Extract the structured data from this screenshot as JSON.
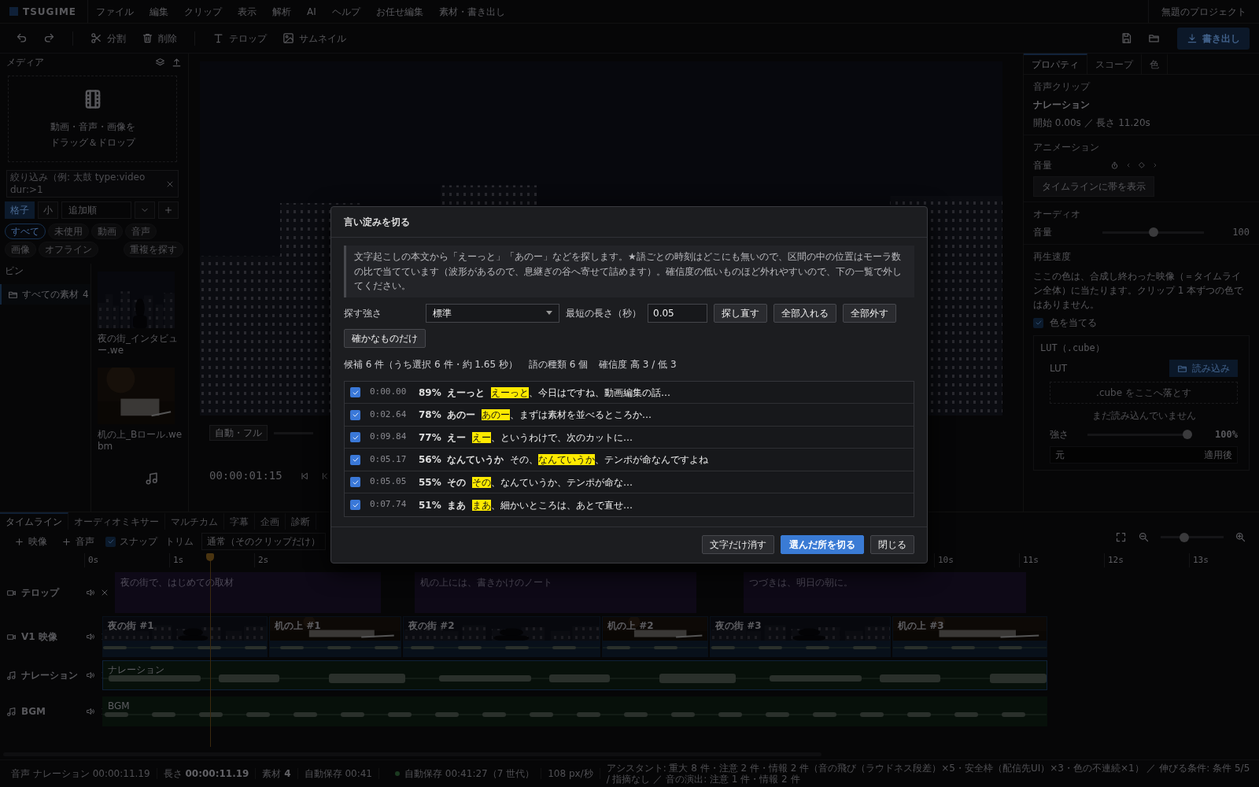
{
  "app": {
    "logo": "TSUGIME",
    "menus": [
      "ファイル",
      "編集",
      "クリップ",
      "表示",
      "解析",
      "AI",
      "ヘルプ",
      "お任せ編集",
      "素材・書き出し"
    ],
    "project": "無題のプロジェクト"
  },
  "toolbar": {
    "left": [
      {
        "kind": "undo"
      },
      {
        "kind": "redo"
      },
      {
        "kind": "split",
        "label": "分割"
      },
      {
        "kind": "delete",
        "label": "削除"
      },
      {
        "kind": "telop",
        "label": "テロップ"
      },
      {
        "kind": "thumbnail",
        "label": "サムネイル"
      }
    ],
    "right": [
      {
        "kind": "save"
      },
      {
        "kind": "open"
      }
    ],
    "export": "書き出し"
  },
  "media": {
    "title": "メディア",
    "drop_text": [
      "動画・音声・画像を",
      "ドラッグ＆ドロップ"
    ],
    "search": {
      "placeholder": "絞り込み（例: 太鼓 type:video dur:>1"
    },
    "view_modes": [
      {
        "label": "格子",
        "selected": true
      },
      {
        "label": "小",
        "selected": false
      }
    ],
    "sort": "追加順",
    "filters": [
      {
        "label": "すべて",
        "selected": true
      },
      {
        "label": "未使用",
        "selected": false
      },
      {
        "label": "動画",
        "selected": false
      },
      {
        "label": "音声",
        "selected": false
      },
      {
        "label": "画像",
        "selected": false
      },
      {
        "label": "オフライン",
        "selected": false
      }
    ],
    "find_duplicates": "重複を探す",
    "bins_title": "ビン",
    "bins": [
      {
        "label": "すべての素材",
        "count": "4",
        "selected": true
      }
    ],
    "items": [
      {
        "kind": "video",
        "name": "夜の街_インタビュー.we"
      },
      {
        "kind": "video",
        "name": "机の上_Bロール.webm"
      },
      {
        "kind": "audio"
      }
    ]
  },
  "preview": {
    "fit_button": "自動・フル",
    "timecode": "00:00:01:15"
  },
  "properties": {
    "tabs": [
      {
        "label": "プロパティ",
        "selected": true
      },
      {
        "label": "スコープ",
        "selected": false
      },
      {
        "label": "色",
        "selected": false
      }
    ],
    "clip_type": "音声クリップ",
    "clip_name": "ナレーション",
    "clip_timing": "開始 0.00s ／ 長さ 11.20s",
    "animation_title": "アニメーション",
    "animation_param": "音量",
    "band_button": "タイムラインに帯を表示",
    "audio_title": "オーディオ",
    "volume": {
      "label": "音量",
      "level": 0.5,
      "reading": "100"
    },
    "speed_title": "再生速度",
    "color_note": "ここの色は、合成し終わった映像（＝タイムライン全体）に当たります。クリップ 1 本ずつの色ではありません。",
    "apply_color": {
      "label": "色を当てる",
      "checked": true
    },
    "lut": {
      "title": "LUT（.cube）",
      "label": "LUT",
      "load_button": "読み込み",
      "drop_text": ".cube をここへ落とす",
      "status": "まだ読み込んでいません",
      "strength": {
        "label": "強さ",
        "level": 1,
        "reading": "100%"
      },
      "compare": {
        "before": "元",
        "after": "適用後"
      }
    }
  },
  "timeline": {
    "tabs": [
      {
        "label": "タイムライン",
        "selected": true
      },
      {
        "label": "オーディオミキサー",
        "selected": false
      },
      {
        "label": "マルチカム",
        "selected": false
      },
      {
        "label": "字幕",
        "selected": false
      },
      {
        "label": "企画",
        "selected": false
      },
      {
        "label": "診断",
        "selected": false
      }
    ],
    "add_video": "映像",
    "add_audio": "音声",
    "snap": {
      "label": "スナップ",
      "checked": true
    },
    "trim_label": "トリム",
    "trim_mode": "通常（そのクリップだけ）",
    "zoom": {
      "level": 0.35
    },
    "ruler": [
      "0s",
      "1s",
      "2s",
      "10s",
      "11s",
      "12s",
      "13s"
    ],
    "tracks": [
      {
        "kind": "text",
        "name": "テロップ",
        "clips": [
          {
            "label": "夜の街で、はじめての取材",
            "selected": false
          },
          {
            "label": "机の上には、書きかけのノート",
            "selected": false
          },
          {
            "label": "つづきは、明日の朝に。",
            "selected": false
          }
        ]
      },
      {
        "kind": "video",
        "name": "V1 映像",
        "clips": [
          {
            "label": "夜の街 #1",
            "selected": false
          },
          {
            "label": "机の上 #1",
            "selected": false
          },
          {
            "label": "夜の街 #2",
            "selected": false
          },
          {
            "label": "机の上 #2",
            "selected": false
          },
          {
            "label": "夜の街 #3",
            "selected": false
          },
          {
            "label": "机の上 #3",
            "selected": false
          }
        ]
      },
      {
        "kind": "audio",
        "name": "ナレーション",
        "clips": [
          {
            "label": "ナレーション",
            "selected": true
          }
        ]
      },
      {
        "kind": "audio",
        "name": "BGM",
        "clips": [
          {
            "label": "BGM",
            "selected": false
          }
        ]
      }
    ]
  },
  "status_bar": [
    {
      "kind": "text",
      "text": "音声  ナレーション  00:00:11.19"
    },
    {
      "kind": "text",
      "text": "長さ **00:00:11.19**"
    },
    {
      "kind": "text",
      "text": "素材 **4**"
    },
    {
      "kind": "text",
      "text": "自動保存 00:41"
    },
    {
      "kind": "saved",
      "text": "自動保存 00:41:27（7 世代）"
    },
    {
      "kind": "text",
      "text": "108 px/秒"
    },
    {
      "kind": "text",
      "text": "アシスタント: 重大 8 件・注意 2 件・情報 2 件（音の飛び（ラウドネス段差）×5・安全枠（配信先UI）×3・色の不連続×1） ／ 伸びる条件: 条件 5/5 / 指摘なし ／ 音の演出: 注意 1 件・情報 2 件"
    }
  ],
  "dialog": {
    "title": "言い淀みを切る",
    "notice": "文字起こしの本文から「えーっと」「あのー」などを探します。★語ごとの時刻はどこにも無いので、区間の中の位置はモーラ数の比で当てています（波形があるので、息継ぎの谷へ寄せて詰めます）。確信度の低いものほど外れやすいので、下の一覧で外してください。",
    "strength_label": "探す強さ",
    "strength_value": "標準",
    "min_length_label": "最短の長さ（秒）",
    "min_length_value": "0.05",
    "actions": [
      "探し直す",
      "全部入れる",
      "全部外す",
      "確かなものだけ"
    ],
    "summary": [
      "候補 6 件（うち選択 6 件・約 1.65 秒）",
      "語の種類 6 個",
      "確信度 高 3 / 低 3"
    ],
    "candidates": [
      {
        "checked": true,
        "time": "0:00.00",
        "confidence": "89%",
        "word": "えーっと",
        "hit": "えーっと",
        "after": "、今日はですね、動画編集の話…"
      },
      {
        "checked": true,
        "time": "0:02.64",
        "confidence": "78%",
        "word": "あのー",
        "hit": "あのー",
        "after": "、まずは素材を並べるところか…"
      },
      {
        "checked": true,
        "time": "0:09.84",
        "confidence": "77%",
        "word": "えー",
        "hit": "えー",
        "after": "、というわけで、次のカットに…"
      },
      {
        "checked": true,
        "time": "0:05.17",
        "confidence": "56%",
        "word": "なんていうか",
        "before": "その、",
        "hit": "なんていうか",
        "after": "、テンポが命なんですよね"
      },
      {
        "checked": true,
        "time": "0:05.05",
        "confidence": "55%",
        "word": "その",
        "hit": "その",
        "after": "、なんていうか、テンポが命な…"
      },
      {
        "checked": true,
        "time": "0:07.74",
        "confidence": "51%",
        "word": "まあ",
        "hit": "まあ",
        "after": "、細かいところは、あとで直せ…"
      }
    ],
    "footer": [
      "文字だけ消す",
      "選んだ所を切る",
      "閉じる"
    ]
  }
}
